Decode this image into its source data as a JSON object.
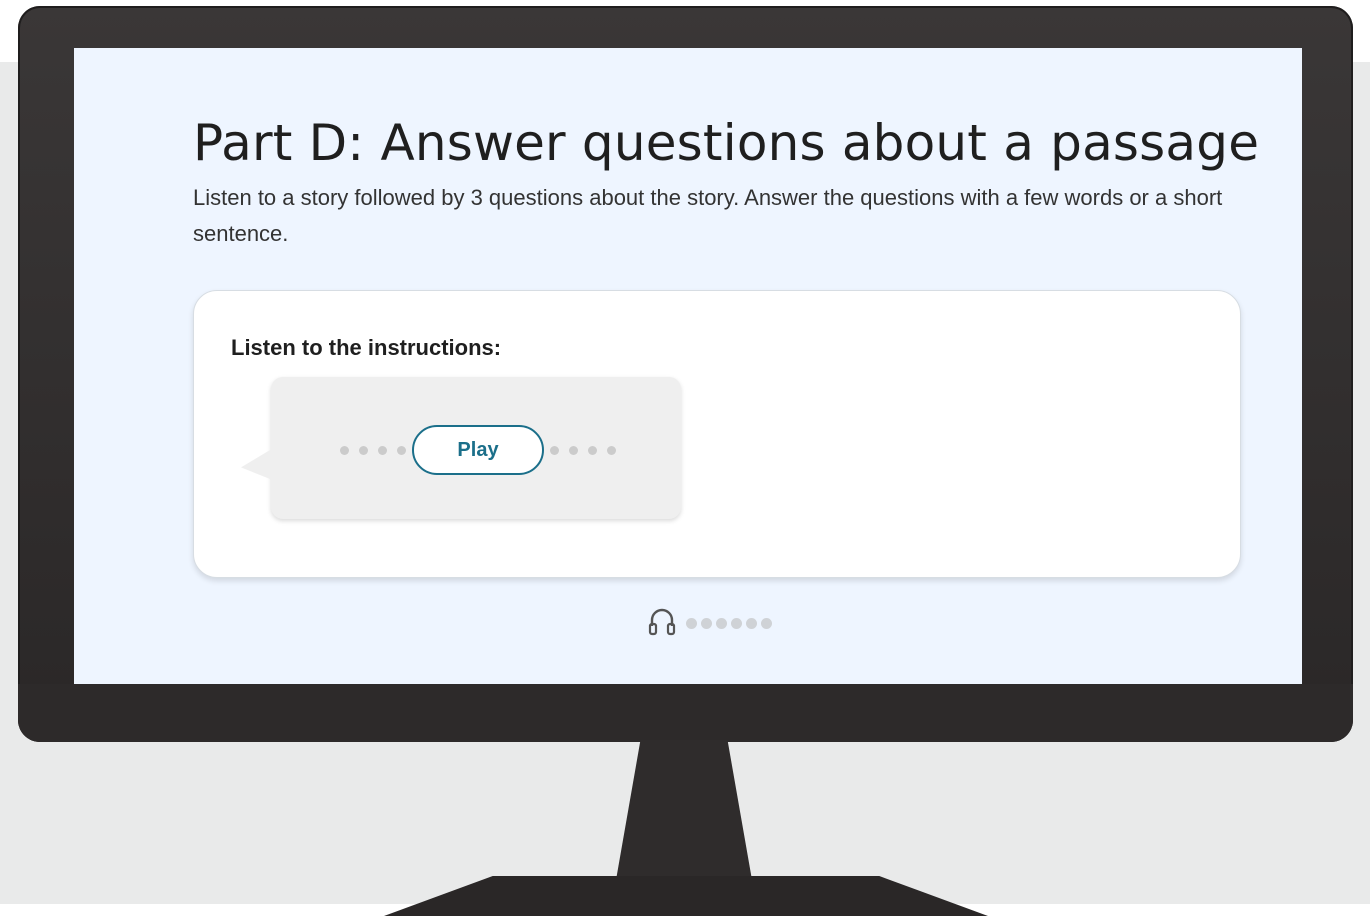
{
  "page": {
    "title": "Part D: Answer questions about a passage",
    "subtitle": "Listen to a story followed by 3 questions about the story. Answer the questions with a few words or a short sentence."
  },
  "instructions_card": {
    "label": "Listen to the instructions:",
    "play_button_label": "Play",
    "icons": [
      "speech-bubble",
      "audio-progress-dots"
    ]
  },
  "footer": {
    "icon": "headphones-icon",
    "progress_dots": 6
  },
  "colors": {
    "screen_bg": "#eef5ff",
    "accent": "#1b6f8a",
    "monitor_frame": "#2d2a2a"
  }
}
